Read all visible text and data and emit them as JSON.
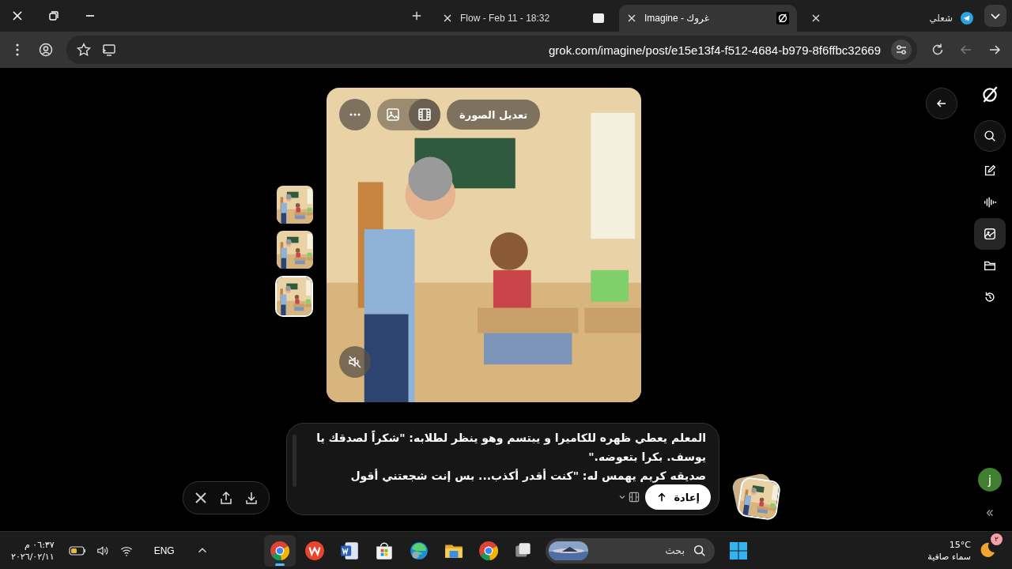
{
  "tabs": [
    {
      "title": "شعلي",
      "selected": false,
      "kind": "telegram"
    },
    {
      "title": "Imagine - غروك",
      "selected": true,
      "kind": "grok"
    },
    {
      "title": "Flow - Feb 11 - 18:32",
      "selected": false,
      "kind": "flow"
    }
  ],
  "address_bar": {
    "url": "grok.com/imagine/post/e15e13f4-f512-4684-b979-8f6ffbc32669"
  },
  "image_toolbar": {
    "edit_button": "تعديل الصورة"
  },
  "thumbnails": [
    {
      "selected": false
    },
    {
      "selected": false
    },
    {
      "selected": true
    }
  ],
  "sidebar": {
    "items": [
      {
        "kind": "logo",
        "selected": false
      },
      {
        "kind": "search",
        "selected": false
      },
      {
        "kind": "edit",
        "selected": false
      },
      {
        "kind": "voice",
        "selected": false
      },
      {
        "kind": "imagine",
        "selected": true
      },
      {
        "kind": "folder",
        "selected": false
      },
      {
        "kind": "history",
        "selected": false
      }
    ]
  },
  "user": {
    "initial": "j"
  },
  "prompt": {
    "value": "المعلم يعطي ظهره للكاميرا و يبتسم وهو ينظر لطلابه: \"شكراً لصدقك يا\nيوسف. بكرا بتعوضه.\"\nصديقه كريم يهمس له: \"كنت أقدر أكذب... بس إنت شجعتني أقول",
    "submit_button": "إعادة"
  },
  "taskbar": {
    "time": "٠٦:٣٧ م",
    "date": "٢٠٢٦/٠٢/١١",
    "language": "ENG",
    "apps": [
      {
        "kind": "chrome",
        "selected": true
      },
      {
        "kind": "wps",
        "selected": false
      },
      {
        "kind": "word",
        "selected": false
      },
      {
        "kind": "store",
        "selected": false
      },
      {
        "kind": "edge",
        "selected": false
      },
      {
        "kind": "explorer",
        "selected": false
      },
      {
        "kind": "chrome",
        "selected": false
      },
      {
        "kind": "taskview",
        "selected": false
      }
    ],
    "search": {
      "placeholder": "بحث"
    },
    "weather": {
      "badge": "٢",
      "temperature": "15°C",
      "condition": "سماء صافية"
    }
  }
}
